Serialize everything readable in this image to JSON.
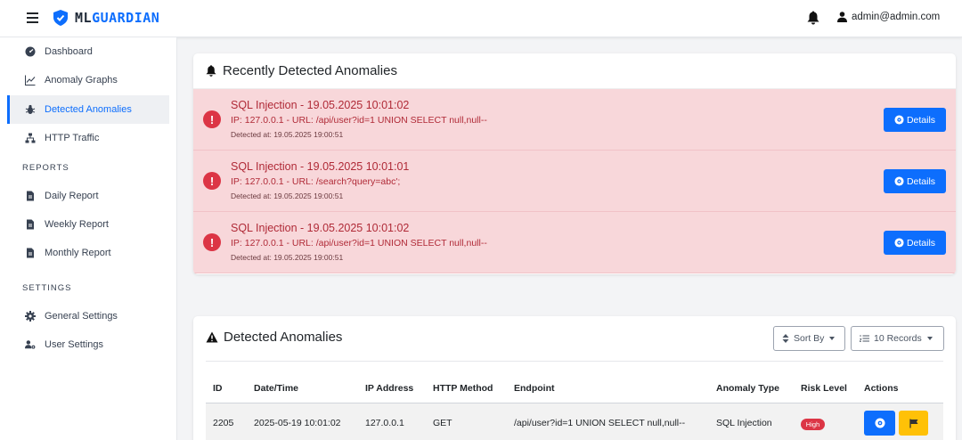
{
  "brand": {
    "prefix": "ML",
    "suffix": "GUARDIAN"
  },
  "header": {
    "user": "admin@admin.com"
  },
  "sidebar": {
    "items": [
      {
        "label": "Dashboard",
        "icon": "dashboard-icon"
      },
      {
        "label": "Anomaly Graphs",
        "icon": "line-chart-icon"
      },
      {
        "label": "Detected Anomalies",
        "icon": "bug-icon",
        "active": true
      },
      {
        "label": "HTTP Traffic",
        "icon": "network-icon"
      }
    ],
    "reports_title": "REPORTS",
    "reports": [
      {
        "label": "Daily Report",
        "icon": "file-icon"
      },
      {
        "label": "Weekly Report",
        "icon": "file-icon"
      },
      {
        "label": "Monthly Report",
        "icon": "file-icon"
      }
    ],
    "settings_title": "SETTINGS",
    "settings": [
      {
        "label": "General Settings",
        "icon": "gear-icon"
      },
      {
        "label": "User Settings",
        "icon": "user-gear-icon"
      }
    ]
  },
  "recent": {
    "title": "Recently Detected Anomalies",
    "details_label": "Details",
    "alerts": [
      {
        "title": "SQL Injection - 19.05.2025 10:01:02",
        "line": "IP: 127.0.0.1 - URL: /api/user?id=1 UNION SELECT null,null--",
        "detected": "Detected at: 19.05.2025 19:00:51"
      },
      {
        "title": "SQL Injection - 19.05.2025 10:01:01",
        "line": "IP: 127.0.0.1 - URL: /search?query=abc';",
        "detected": "Detected at: 19.05.2025 19:00:51"
      },
      {
        "title": "SQL Injection - 19.05.2025 10:01:02",
        "line": "IP: 127.0.0.1 - URL: /api/user?id=1 UNION SELECT null,null--",
        "detected": "Detected at: 19.05.2025 19:00:51"
      }
    ]
  },
  "table": {
    "title": "Detected Anomalies",
    "sort_label": "Sort By",
    "records_label": "10 Records",
    "columns": [
      "ID",
      "Date/Time",
      "IP Address",
      "HTTP Method",
      "Endpoint",
      "Anomaly Type",
      "Risk Level",
      "Actions"
    ],
    "rows": [
      {
        "id": "2205",
        "datetime": "2025-05-19 10:01:02",
        "ip": "127.0.0.1",
        "method": "GET",
        "endpoint": "/api/user?id=1 UNION SELECT null,null--",
        "type": "SQL Injection",
        "risk": "High"
      }
    ]
  },
  "colors": {
    "accent": "#0d6efd",
    "danger": "#dc3545",
    "alert_bg": "#f8d7da",
    "warning": "#ffc107"
  }
}
